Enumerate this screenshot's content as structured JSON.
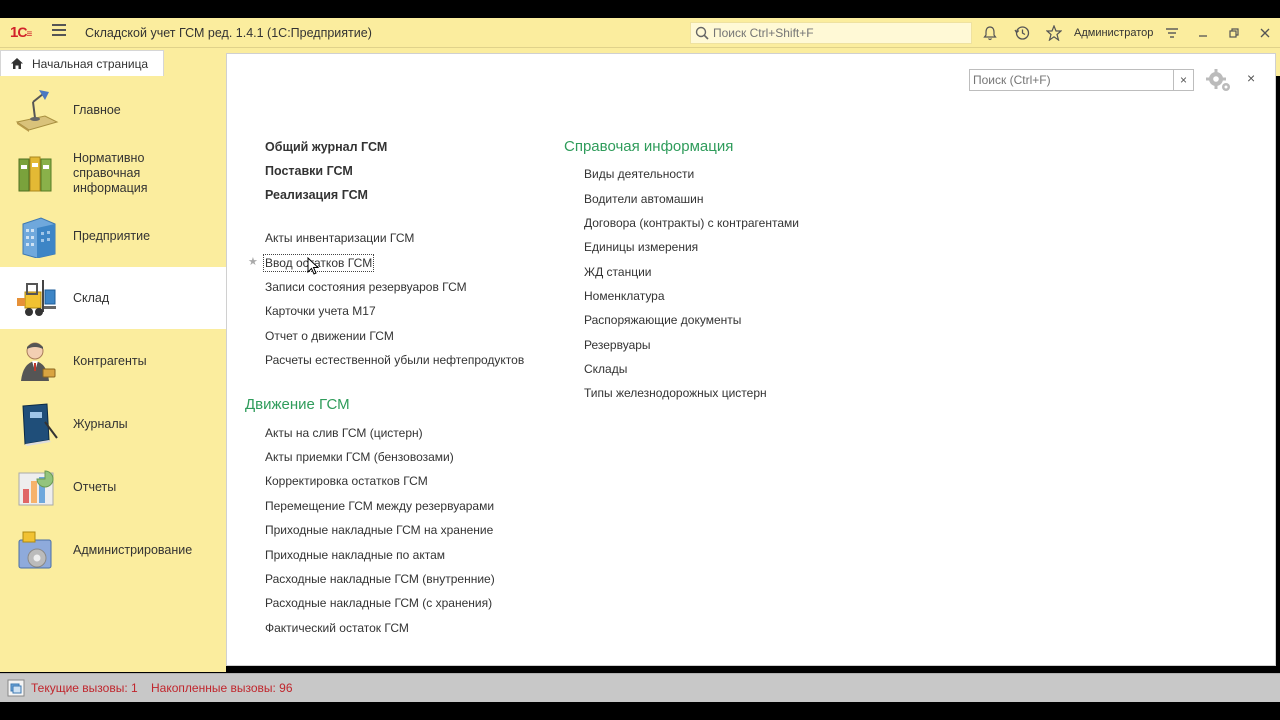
{
  "app": {
    "title": "Складской учет ГСМ ред. 1.4.1  (1С:Предприятие)",
    "search_placeholder": "Поиск Ctrl+Shift+F",
    "user": "Администратор"
  },
  "tabs": {
    "home_label": "Начальная страница"
  },
  "sidebar": {
    "items": [
      {
        "label": "Главное",
        "icon": "desk-lamp-icon"
      },
      {
        "label": "Нормативно справочная информация",
        "icon": "folders-icon"
      },
      {
        "label": "Предприятие",
        "icon": "building-icon"
      },
      {
        "label": "Склад",
        "icon": "forklift-icon",
        "active": true
      },
      {
        "label": "Контрагенты",
        "icon": "person-icon"
      },
      {
        "label": "Журналы",
        "icon": "journal-book-icon"
      },
      {
        "label": "Отчеты",
        "icon": "chart-report-icon"
      },
      {
        "label": "Администрирование",
        "icon": "admin-gear-icon"
      }
    ]
  },
  "content": {
    "search_placeholder": "Поиск (Ctrl+F)",
    "clear": "×",
    "close": "×",
    "col1": {
      "bold_links": [
        "Общий журнал ГСМ",
        "Поставки ГСМ",
        "Реализация ГСМ"
      ],
      "links": [
        "Акты инвентаризации ГСМ",
        "Ввод остатков ГСМ",
        "Записи состояния резервуаров ГСМ",
        "Карточки учета М17",
        "Отчет о движении ГСМ",
        "Расчеты естественной убыли нефтепродуктов"
      ],
      "section2_title": "Движение ГСМ",
      "section2_links": [
        "Акты на слив ГСМ (цистерн)",
        "Акты приемки ГСМ (бензовозами)",
        "Корректировка остатков ГСМ",
        "Перемещение ГСМ между резервуарами",
        "Приходные накладные ГСМ на хранение",
        "Приходные накладные по актам",
        "Расходные накладные ГСМ (внутренние)",
        "Расходные накладные ГСМ (с хранения)",
        "Фактический остаток ГСМ"
      ]
    },
    "col2": {
      "title": "Справочая информация",
      "links": [
        "Виды деятельности",
        "Водители автомашин",
        "Договора (контракты) с контрагентами",
        "Единицы измерения",
        "ЖД станции",
        "Номенклатура",
        "Распоряжающие документы",
        "Резервуары",
        "Склады",
        "Типы железнодорожных цистерн"
      ]
    }
  },
  "status": {
    "text": "Текущие вызовы: 1    Накопленные вызовы: 96"
  },
  "colors": {
    "accent_yellow": "#fbed9e",
    "section_green": "#2f9c5b",
    "status_red": "#c0262d"
  }
}
